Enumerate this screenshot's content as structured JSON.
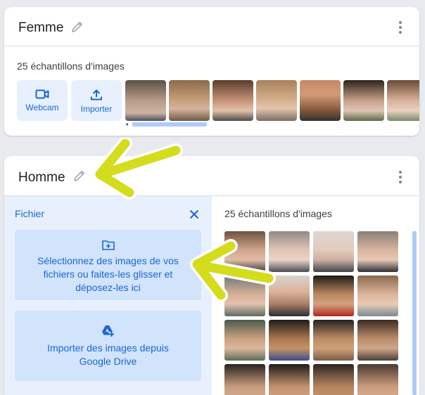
{
  "classes": [
    {
      "title": "Femme",
      "samples_label": "25 échantillons d'images",
      "webcam_label": "Webcam",
      "upload_label": "Importer"
    },
    {
      "title": "Homme",
      "samples_label": "25 échantillons d'images",
      "upload_panel": {
        "title": "Fichier",
        "drop_text": "Sélectionnez des images de vos fichiers ou faites-les glisser et déposez-les ici",
        "drive_text": "Importer des images depuis Google Drive"
      }
    }
  ],
  "colors": {
    "accent": "#1967d2",
    "panel_bg": "#e8f0fe",
    "tile_bg": "#d2e3fc",
    "arrow": "#d4dc1e"
  },
  "icons": [
    "pencil-icon",
    "more-vert-icon",
    "videocam-icon",
    "upload-icon",
    "close-icon",
    "add-folder-icon",
    "google-drive-icon"
  ]
}
